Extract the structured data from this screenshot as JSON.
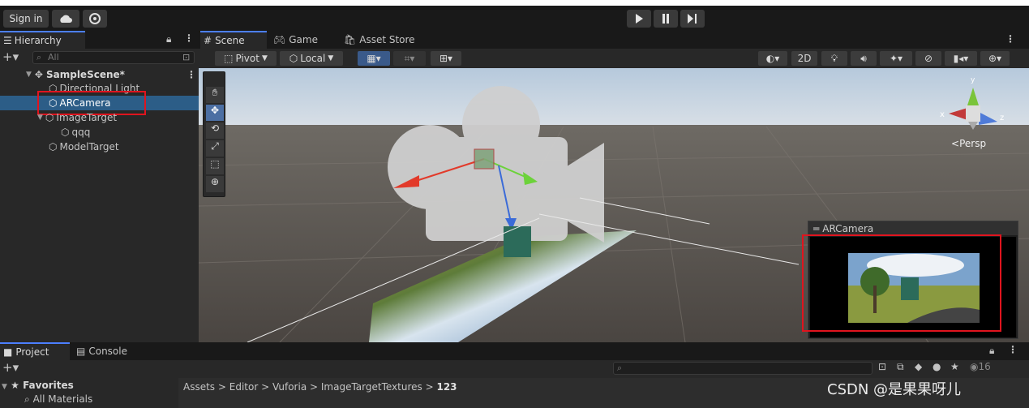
{
  "toolbar": {
    "signin": "Sign in"
  },
  "hierarchy": {
    "tab": "Hierarchy",
    "search_placeholder": "All",
    "scene": "SampleScene*",
    "items": [
      {
        "label": "Directional Light"
      },
      {
        "label": "ARCamera"
      },
      {
        "label": "ImageTarget"
      },
      {
        "label": "qqq"
      },
      {
        "label": "ModelTarget"
      }
    ]
  },
  "scene_tabs": {
    "scene": "Scene",
    "game": "Game",
    "asset_store": "Asset Store"
  },
  "scene_toolbar": {
    "pivot": "Pivot",
    "local": "Local",
    "twod": "2D"
  },
  "gizmo": {
    "persp": "Persp",
    "x": "x",
    "y": "y",
    "z": "z"
  },
  "preview": {
    "title": "ARCamera"
  },
  "project": {
    "tab_project": "Project",
    "tab_console": "Console",
    "favorites": "Favorites",
    "all_materials": "All Materials",
    "count": "16",
    "breadcrumb": [
      "Assets",
      "Editor",
      "Vuforia",
      "ImageTargetTextures",
      "123"
    ]
  },
  "watermark": "CSDN @是果果呀儿",
  "colors": {
    "selection": "#2c5d87",
    "accent": "#4c7fff",
    "highlight_box": "#e0141e"
  }
}
